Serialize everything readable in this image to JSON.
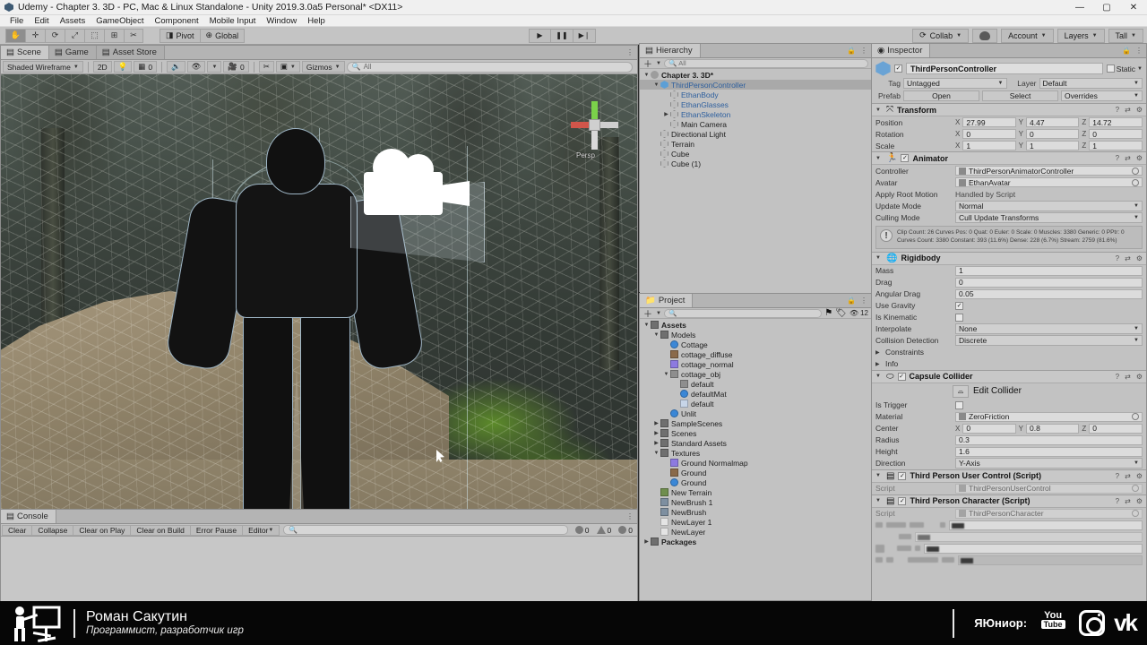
{
  "window": {
    "title": "Udemy - Chapter 3. 3D - PC, Mac & Linux Standalone - Unity 2019.3.0a5 Personal* <DX11>",
    "minimize": "—",
    "maximize": "▢",
    "close": "✕"
  },
  "menu": [
    "File",
    "Edit",
    "Assets",
    "GameObject",
    "Component",
    "Mobile Input",
    "Window",
    "Help"
  ],
  "toolbar": {
    "tools": [
      {
        "name": "hand-tool",
        "glyph": "✋",
        "active": true
      },
      {
        "name": "move-tool",
        "glyph": "✛",
        "active": false
      },
      {
        "name": "rotate-tool",
        "glyph": "⟳",
        "active": false
      },
      {
        "name": "scale-tool",
        "glyph": "⤢",
        "active": false
      },
      {
        "name": "rect-tool",
        "glyph": "⬚",
        "active": false
      },
      {
        "name": "transform-tool",
        "glyph": "⊞",
        "active": false
      },
      {
        "name": "custom-tool",
        "glyph": "✂",
        "active": false
      }
    ],
    "pivot": "Pivot",
    "global": "Global",
    "play": "▶",
    "pause": "❚❚",
    "step": "▶❘",
    "collab": "Collab",
    "account": "Account",
    "layers": "Layers",
    "layout": "Tall"
  },
  "scene": {
    "tabs": [
      {
        "label": "Scene",
        "active": true
      },
      {
        "label": "Game",
        "active": false
      },
      {
        "label": "Asset Store",
        "active": false
      }
    ],
    "shading": "Shaded Wireframe",
    "mode2d": "2D",
    "light_count": "0",
    "audio_count": "0",
    "gizmos": "Gizmos",
    "search_placeholder": "All",
    "perspective_label": "Persp"
  },
  "console": {
    "tab": "Console",
    "buttons": [
      "Clear",
      "Collapse",
      "Clear on Play",
      "Clear on Build",
      "Error Pause"
    ],
    "editor": "Editor",
    "search_placeholder": "",
    "log_count": "0",
    "warning_count": "0",
    "error_count": "0"
  },
  "hierarchy": {
    "tab": "Hierarchy",
    "search_placeholder": "All",
    "items": [
      {
        "label": "Chapter 3. 3D*",
        "depth": 0,
        "icon": "scene-icon",
        "arrow": "▼",
        "bold": true,
        "blue": false,
        "selected": false
      },
      {
        "label": "ThirdPersonController",
        "depth": 1,
        "icon": "prefab-icon",
        "arrow": "▼",
        "bold": false,
        "blue": true,
        "selected": true
      },
      {
        "label": "EthanBody",
        "depth": 2,
        "icon": "cube-icon",
        "arrow": "",
        "bold": false,
        "blue": true,
        "selected": false
      },
      {
        "label": "EthanGlasses",
        "depth": 2,
        "icon": "cube-icon",
        "arrow": "",
        "bold": false,
        "blue": true,
        "selected": false
      },
      {
        "label": "EthanSkeleton",
        "depth": 2,
        "icon": "cube-icon",
        "arrow": "▶",
        "bold": false,
        "blue": true,
        "selected": false
      },
      {
        "label": "Main Camera",
        "depth": 2,
        "icon": "cube-icon",
        "arrow": "",
        "bold": false,
        "blue": false,
        "selected": false
      },
      {
        "label": "Directional Light",
        "depth": 1,
        "icon": "cube-icon",
        "arrow": "",
        "bold": false,
        "blue": false,
        "selected": false
      },
      {
        "label": "Terrain",
        "depth": 1,
        "icon": "cube-icon",
        "arrow": "",
        "bold": false,
        "blue": false,
        "selected": false
      },
      {
        "label": "Cube",
        "depth": 1,
        "icon": "cube-icon",
        "arrow": "",
        "bold": false,
        "blue": false,
        "selected": false
      },
      {
        "label": "Cube (1)",
        "depth": 1,
        "icon": "cube-icon",
        "arrow": "",
        "bold": false,
        "blue": false,
        "selected": false
      }
    ]
  },
  "project": {
    "tab": "Project",
    "search_placeholder": "",
    "badge_count": "12",
    "items": [
      {
        "label": "Assets",
        "depth": 0,
        "icon": "folder-icon",
        "arrow": "▼",
        "bold": true
      },
      {
        "label": "Models",
        "depth": 1,
        "icon": "folder-icon",
        "arrow": "▼",
        "bold": false
      },
      {
        "label": "Cottage",
        "depth": 2,
        "icon": "material-icon",
        "arrow": "",
        "bold": false
      },
      {
        "label": "cottage_diffuse",
        "depth": 2,
        "icon": "texture-icon",
        "arrow": "",
        "bold": false
      },
      {
        "label": "cottage_normal",
        "depth": 2,
        "icon": "normalmap-icon",
        "arrow": "",
        "bold": false
      },
      {
        "label": "cottage_obj",
        "depth": 2,
        "icon": "mesh-icon",
        "arrow": "▼",
        "bold": false
      },
      {
        "label": "default",
        "depth": 3,
        "icon": "mesh-icon",
        "arrow": "",
        "bold": false
      },
      {
        "label": "defaultMat",
        "depth": 3,
        "icon": "material-icon",
        "arrow": "",
        "bold": false
      },
      {
        "label": "default",
        "depth": 3,
        "icon": "grid-icon",
        "arrow": "",
        "bold": false
      },
      {
        "label": "Unlit",
        "depth": 2,
        "icon": "material-icon",
        "arrow": "",
        "bold": false
      },
      {
        "label": "SampleScenes",
        "depth": 1,
        "icon": "folder-icon",
        "arrow": "▶",
        "bold": false
      },
      {
        "label": "Scenes",
        "depth": 1,
        "icon": "folder-icon",
        "arrow": "▶",
        "bold": false
      },
      {
        "label": "Standard Assets",
        "depth": 1,
        "icon": "folder-icon",
        "arrow": "▶",
        "bold": false
      },
      {
        "label": "Textures",
        "depth": 1,
        "icon": "folder-icon",
        "arrow": "▼",
        "bold": false
      },
      {
        "label": "Ground Normalmap",
        "depth": 2,
        "icon": "normalmap-icon",
        "arrow": "",
        "bold": false
      },
      {
        "label": "Ground",
        "depth": 2,
        "icon": "texture-icon",
        "arrow": "",
        "bold": false
      },
      {
        "label": "Ground",
        "depth": 2,
        "icon": "material-icon",
        "arrow": "",
        "bold": false
      },
      {
        "label": "New Terrain",
        "depth": 1,
        "icon": "terrain-icon",
        "arrow": "",
        "bold": false
      },
      {
        "label": "NewBrush 1",
        "depth": 1,
        "icon": "brush-icon",
        "arrow": "",
        "bold": false
      },
      {
        "label": "NewBrush",
        "depth": 1,
        "icon": "brush-icon",
        "arrow": "",
        "bold": false
      },
      {
        "label": "NewLayer 1",
        "depth": 1,
        "icon": "layer-icon",
        "arrow": "",
        "bold": false
      },
      {
        "label": "NewLayer",
        "depth": 1,
        "icon": "layer-icon",
        "arrow": "",
        "bold": false
      },
      {
        "label": "Packages",
        "depth": 0,
        "icon": "folder-icon",
        "arrow": "▶",
        "bold": true
      }
    ]
  },
  "inspector": {
    "tab": "Inspector",
    "object_name": "ThirdPersonController",
    "enabled": true,
    "static_label": "Static",
    "tag_label": "Tag",
    "tag_value": "Untagged",
    "layer_label": "Layer",
    "layer_value": "Default",
    "prefab_label": "Prefab",
    "prefab_open": "Open",
    "prefab_select": "Select",
    "prefab_overrides": "Overrides",
    "transform": {
      "title": "Transform",
      "position_label": "Position",
      "position": {
        "x": "27.99",
        "y": "4.47",
        "z": "14.72"
      },
      "rotation_label": "Rotation",
      "rotation": {
        "x": "0",
        "y": "0",
        "z": "0"
      },
      "scale_label": "Scale",
      "scale": {
        "x": "1",
        "y": "1",
        "z": "1"
      }
    },
    "animator": {
      "title": "Animator",
      "controller_label": "Controller",
      "controller_value": "ThirdPersonAnimatorController",
      "avatar_label": "Avatar",
      "avatar_value": "EthanAvatar",
      "apply_root_motion_label": "Apply Root Motion",
      "apply_root_motion_value": "Handled by Script",
      "update_mode_label": "Update Mode",
      "update_mode_value": "Normal",
      "culling_mode_label": "Culling Mode",
      "culling_mode_value": "Cull Update Transforms",
      "info_text": "Clip Count: 26\nCurves Pos: 0 Quat: 0 Euler: 0 Scale: 0 Muscles: 3380 Generic: 0 PPtr: 0\nCurves Count: 3380 Constant: 393 (11.6%) Dense: 228 (6.7%) Stream: 2759 (81.6%)"
    },
    "rigidbody": {
      "title": "Rigidbody",
      "mass_label": "Mass",
      "mass_value": "1",
      "drag_label": "Drag",
      "drag_value": "0",
      "angular_drag_label": "Angular Drag",
      "angular_drag_value": "0.05",
      "use_gravity_label": "Use Gravity",
      "use_gravity_value": true,
      "is_kinematic_label": "Is Kinematic",
      "is_kinematic_value": false,
      "interpolate_label": "Interpolate",
      "interpolate_value": "None",
      "collision_detection_label": "Collision Detection",
      "collision_detection_value": "Discrete",
      "constraints_label": "Constraints",
      "info_label": "Info"
    },
    "capsule_collider": {
      "title": "Capsule Collider",
      "edit_collider": "Edit Collider",
      "is_trigger_label": "Is Trigger",
      "is_trigger_value": false,
      "material_label": "Material",
      "material_value": "ZeroFriction",
      "center_label": "Center",
      "center": {
        "x": "0",
        "y": "0.8",
        "z": "0"
      },
      "radius_label": "Radius",
      "radius_value": "0.3",
      "height_label": "Height",
      "height_value": "1.6",
      "direction_label": "Direction",
      "direction_value": "Y-Axis"
    },
    "user_control": {
      "title": "Third Person User Control (Script)",
      "script_label": "Script",
      "script_value": "ThirdPersonUserControl"
    },
    "character": {
      "title": "Third Person Character (Script)",
      "script_label": "Script",
      "script_value": "ThirdPersonCharacter"
    }
  },
  "banner": {
    "name": "Роман Сакутин",
    "subtitle": "Программист, разработчик игр",
    "channel_label": "ЯЮниор:",
    "youtube_top": "You",
    "youtube_bottom": "Tube",
    "vk": "vk"
  }
}
